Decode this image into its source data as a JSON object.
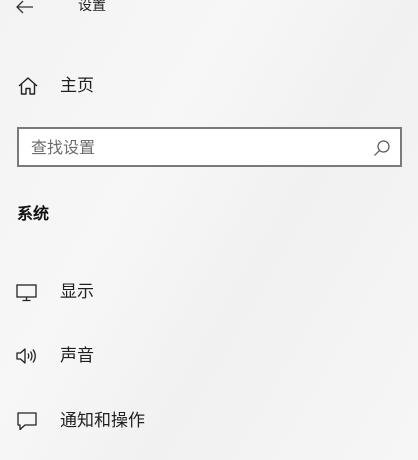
{
  "window": {
    "title": "设置"
  },
  "home": {
    "label": "主页",
    "icon": "home-icon"
  },
  "search": {
    "placeholder": "查找设置",
    "value": "",
    "icon": "search-icon"
  },
  "section": {
    "heading": "系统"
  },
  "nav": {
    "items": [
      {
        "label": "显示",
        "icon": "display-icon"
      },
      {
        "label": "声音",
        "icon": "speaker-icon"
      },
      {
        "label": "通知和操作",
        "icon": "notification-icon"
      }
    ]
  },
  "colors": {
    "text": "#1f1f1f",
    "search_border": "#7a7a7a",
    "background": "#f3f3f3"
  }
}
